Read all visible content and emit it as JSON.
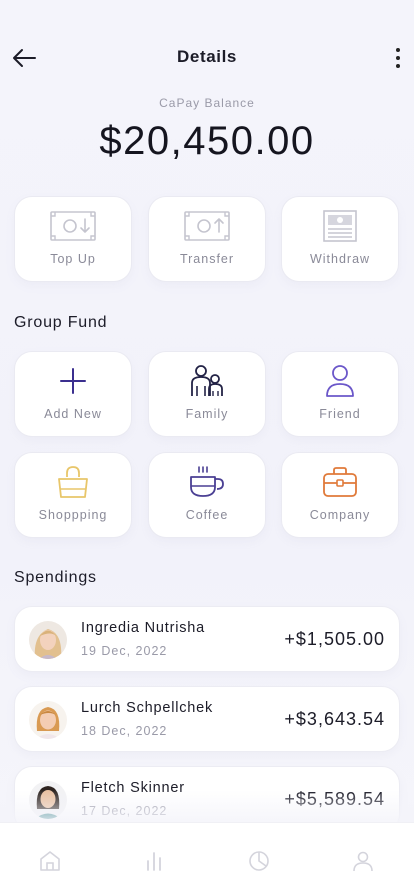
{
  "header": {
    "title": "Details"
  },
  "balance": {
    "label": "CaPay Balance",
    "amount": "$20,450.00"
  },
  "actions": [
    {
      "label": "Top Up",
      "icon": "top-up-icon"
    },
    {
      "label": "Transfer",
      "icon": "transfer-icon"
    },
    {
      "label": "Withdraw",
      "icon": "withdraw-icon"
    }
  ],
  "group_fund": {
    "title": "Group Fund",
    "items": [
      {
        "label": "Add New",
        "icon": "plus-icon",
        "color": "#3b2f8f"
      },
      {
        "label": "Family",
        "icon": "family-icon",
        "color": "#232346"
      },
      {
        "label": "Friend",
        "icon": "person-icon",
        "color": "#6b57c9"
      },
      {
        "label": "Shoppping",
        "icon": "shopping-bag-icon",
        "color": "#e8c66a"
      },
      {
        "label": "Coffee",
        "icon": "coffee-cup-icon",
        "color": "#4a3f93"
      },
      {
        "label": "Company",
        "icon": "briefcase-icon",
        "color": "#e07a3a"
      }
    ]
  },
  "spendings": {
    "title": "Spendings",
    "items": [
      {
        "name": "Ingredia Nutrisha",
        "date": "19 Dec, 2022",
        "amount": "+$1,505.00",
        "avatar": "avatar-blonde-woman"
      },
      {
        "name": "Lurch Schpellchek",
        "date": "18 Dec, 2022",
        "amount": "+$3,643.54",
        "avatar": "avatar-smiling-woman"
      },
      {
        "name": "Fletch Skinner",
        "date": "17 Dec, 2022",
        "amount": "+$5,589.54",
        "avatar": "avatar-dark-hair-woman"
      }
    ]
  },
  "bottom_nav": [
    {
      "icon": "home-icon"
    },
    {
      "icon": "stats-icon"
    },
    {
      "icon": "pie-chart-icon"
    },
    {
      "icon": "profile-icon"
    }
  ]
}
